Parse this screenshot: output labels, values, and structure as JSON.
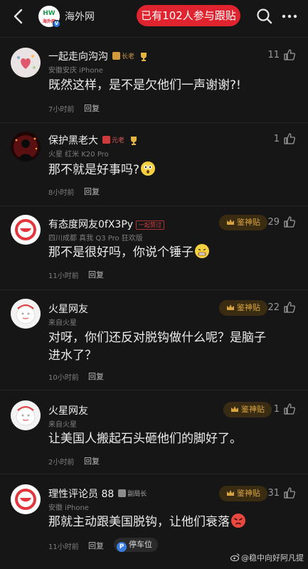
{
  "header": {
    "logo_text": "海外网",
    "site_name": "海外网",
    "follow_pill": "已有102人参与跟贴"
  },
  "comments": [
    {
      "user": "一起走向沟沟",
      "badge": "长老",
      "meta": "安徽安庆  iPhone",
      "text": "既然这样，是不是欠他们一声谢谢?!",
      "time": "7小时前",
      "reply": "回复",
      "likes": "11"
    },
    {
      "user": "保护黑老大",
      "badge": "元老",
      "meta": "火星  红米 K20 Pro",
      "text": "那不就是好事吗?",
      "time": "8小时前",
      "reply": "回复",
      "likes": "1"
    },
    {
      "user": "有态度网友0fX3Py",
      "badge": "一起赞过",
      "meta": "四川成都  真我 Q3 Pro 狂欢版",
      "text": "那不是很好吗，你说个锤子",
      "time": "11小时前",
      "reply": "回复",
      "likes": "29",
      "god": "鉴神贴"
    },
    {
      "user": "火星网友",
      "meta": "来自火星",
      "text": "对呀，你们还反对脱钩做什么呢？是脑子进水了？",
      "time": "10小时前",
      "reply": "回复",
      "likes": "22",
      "god": "鉴神贴"
    },
    {
      "user": "火星网友",
      "meta": "来自火星",
      "text": "让美国人搬起石头砸他们的脚好了。",
      "time": "2小时前",
      "reply": "回复",
      "likes": "1",
      "god": "鉴神贴"
    },
    {
      "user": "理性评论员 88",
      "badge": "副局长",
      "meta": "安徽  iPhone",
      "text": "那就主动跟美国脱钩，让他们衰落",
      "time": "11小时前",
      "reply": "回复",
      "likes": "31",
      "god": "鉴神贴",
      "parking": "停车位"
    }
  ],
  "watermark": "@稳中向好阿凡提"
}
